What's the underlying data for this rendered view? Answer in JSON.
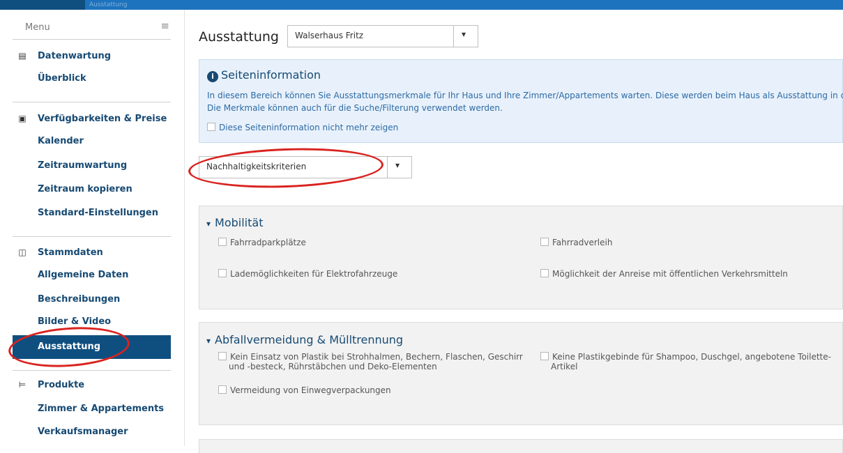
{
  "top_partial": "Ausstattung",
  "sidebar": {
    "menu_label": "Menu",
    "sections": [
      {
        "label": "Datenwartung",
        "icon": "document-icon",
        "items": [
          "Überblick"
        ]
      },
      {
        "label": "Verfügbarkeiten & Preise",
        "icon": "money-icon",
        "items": [
          "Kalender",
          "Zeitraumwartung",
          "Zeitraum kopieren",
          "Standard-Einstellungen"
        ]
      },
      {
        "label": "Stammdaten",
        "icon": "columns-icon",
        "items": [
          "Allgemeine Daten",
          "Beschreibungen",
          "Bilder & Video",
          "Ausstattung"
        ]
      },
      {
        "label": "Produkte",
        "icon": "bed-icon",
        "items": [
          "Zimmer & Appartements",
          "Verkaufsmanager"
        ]
      }
    ],
    "active_item": "Ausstattung"
  },
  "main": {
    "title": "Ausstattung",
    "house_select": "Walserhaus Fritz",
    "info": {
      "title": "Seiteninformation",
      "line1": "In diesem Bereich können Sie Ausstattungsmerkmale für Ihr Haus und Ihre Zimmer/Appartements warten. Diese werden beim Haus als Ausstattung in der",
      "line2": "Die Merkmale können auch für die Suche/Filterung verwendet werden.",
      "dismiss": "Diese Seiteninformation nicht mehr zeigen"
    },
    "category_select": "Nachhaltigkeitskriterien",
    "panels": [
      {
        "title": "Mobilität",
        "options": [
          "Fahrradparkplätze",
          "Fahrradverleih",
          "Lademöglichkeiten für Elektrofahrzeuge",
          "Möglichkeit der Anreise mit öffentlichen Verkehrsmitteln"
        ]
      },
      {
        "title": "Abfallvermeidung & Mülltrennung",
        "options": [
          "Kein Einsatz von Plastik bei Strohhalmen, Bechern, Flaschen, Geschirr",
          "und -besteck, Rührstäbchen und Deko-Elementen",
          "Keine Plastikgebinde für Shampoo, Duschgel, angebotene Toilette-",
          "Artikel",
          "Vermeidung von Einwegverpackungen"
        ]
      }
    ]
  },
  "colors": {
    "brand": "#0f4f80",
    "link": "#174a73",
    "annotation": "#d9231f",
    "info_bg": "#e8f1fb"
  }
}
